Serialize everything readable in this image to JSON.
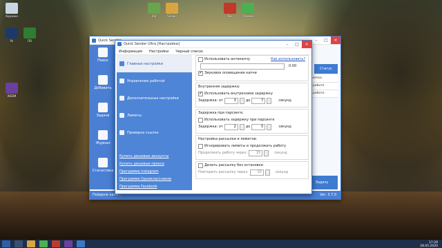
{
  "window": {
    "title": "Quick Sender",
    "status_btn": "Статус",
    "right_list": [
      "наличия лятка",
      "Работе к работе",
      "Работе к работе"
    ],
    "zadachu": "Задачу",
    "status_left": "Пойдено капч...",
    "version": "Ver: 3.7.0"
  },
  "main_sidebar": [
    {
      "label": "Поиск"
    },
    {
      "label": "Добавить"
    },
    {
      "label": "Задачи"
    },
    {
      "label": "Журнал"
    },
    {
      "label": "Статистика"
    }
  ],
  "dialog": {
    "title": "Quick Sender Ultra [Настройки]",
    "menu": [
      "Информация",
      "Настройки",
      "Черный список"
    ],
    "nav": [
      {
        "label": "Главные настройки"
      },
      {
        "label": "Управление работой"
      },
      {
        "label": "Дополнительные настройки"
      },
      {
        "label": "Лимиты"
      },
      {
        "label": "Проверка ссылок"
      }
    ],
    "links": [
      "Купить дешевые аккаунты",
      "Купить дешевые прокси",
      "Программа Instagram",
      "Программа Одноклассников",
      "Программа Facebook"
    ],
    "anticaptcha": {
      "label": "Использовать антикапчу",
      "help": "Как использовать?",
      "balance": "0.00"
    },
    "sound": "Звуковое оповещение капчи",
    "inner_delay": {
      "title": "Внутренняя задержка:",
      "use": "Использовать внутреннюю задержку",
      "delay_label": "Задержка: от",
      "from": "3",
      "to_label": "до",
      "to": "7",
      "unit": "секунд"
    },
    "parse_delay": {
      "title": "Задержка при парсинге:",
      "use": "Использовать задержку при парсинге",
      "delay_label": "Задержка: от",
      "from": "2",
      "to_label": "до",
      "to": "5",
      "unit": "секунд"
    },
    "limits": {
      "title": "Настройка рассылки и лимитов:",
      "ignore": "Игнорировать лимиты и продолжать работу",
      "continue": "Продолжать работу через:",
      "continue_val": "15",
      "unit": "секунд"
    },
    "mailing": {
      "endless": "Делать рассылку без остановки",
      "repeat": "Повторить рассылку через:",
      "repeat_val": "10",
      "unit": "секунд"
    }
  },
  "desktop_icons": [
    {
      "label": "Корзина",
      "color": "#c8d6e8"
    },
    {
      "label": "Vid",
      "color": "#6ba34f"
    },
    {
      "label": "Simple",
      "color": "#d9a441"
    },
    {
      "label": "Res",
      "color": "#c0392b"
    },
    {
      "label": "Chrome",
      "color": "#4caf50"
    },
    {
      "label": "Ps",
      "color": "#1b3a6b"
    },
    {
      "label": "ПО",
      "color": "#2e7d32"
    },
    {
      "label": "WEBM",
      "color": "#6a3fa0"
    }
  ],
  "clock": {
    "time": "17:29",
    "date": "28.05.2020"
  }
}
